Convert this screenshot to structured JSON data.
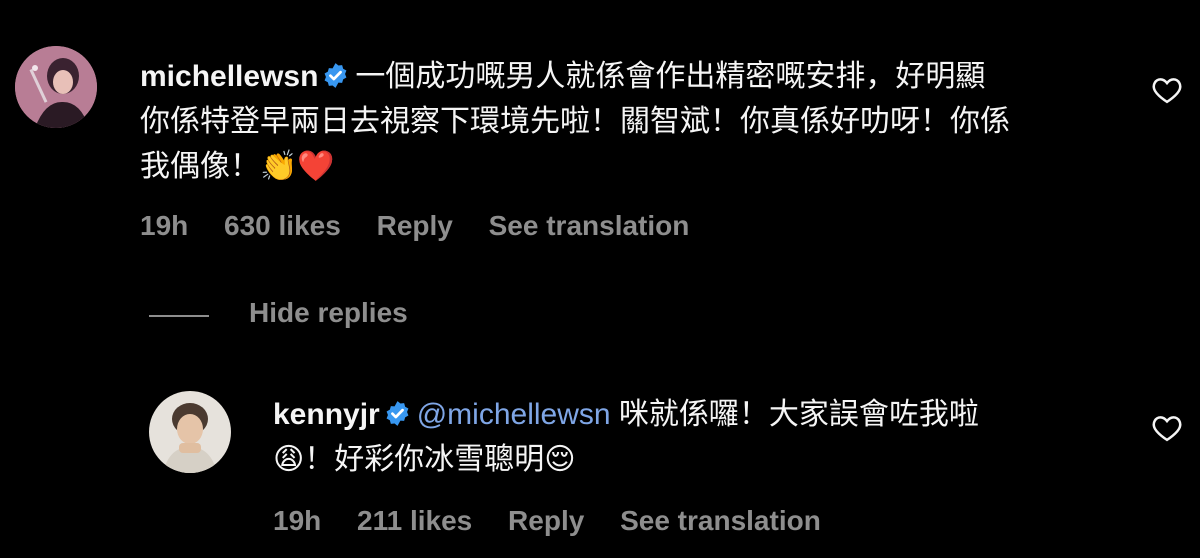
{
  "comments": [
    {
      "username": "michellewsn",
      "text_lines": [
        "一個成功嘅男人就係會作出精密嘅安排，好明顯",
        "你係特登早兩日去視察下環境先啦！關智斌！你真係好叻呀！你係",
        "我偶像！"
      ],
      "emojis": "👏❤️",
      "time": "19h",
      "likes": "630 likes",
      "reply_label": "Reply",
      "translate_label": "See translation"
    }
  ],
  "replies_toggle": {
    "label": "Hide replies"
  },
  "replies": [
    {
      "username": "kennyjr",
      "mention": "@michellewsn",
      "text_line1": " 咪就係囉！大家誤會咗我啦",
      "emoji_lead": "😩",
      "text_line2": "！好彩你冰雪聰明",
      "emoji_tail": "😌",
      "time": "19h",
      "likes": "211 likes",
      "reply_label": "Reply",
      "translate_label": "See translation"
    }
  ],
  "icons": {
    "verified": "verified-badge-icon",
    "like": "heart-outline-icon"
  },
  "colors": {
    "background": "#000000",
    "text": "#f5f5f5",
    "secondary": "#8e8e8e",
    "mention": "#7fa6e6",
    "verified": "#3897f0"
  }
}
